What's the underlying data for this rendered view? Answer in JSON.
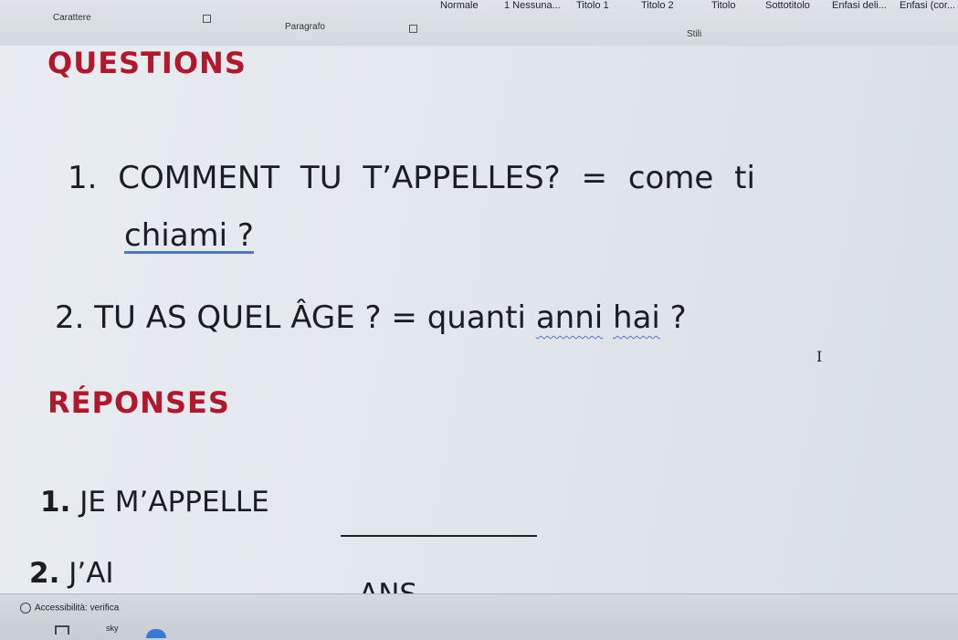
{
  "ribbon": {
    "group_font": "Carattere",
    "group_paragraph": "Paragrafo",
    "group_styles": "Stili",
    "styles": [
      "Normale",
      "1 Nessuna...",
      "Titolo 1",
      "Titolo 2",
      "Titolo",
      "Sottotitolo",
      "Enfasi deli...",
      "Enfasi (cor..."
    ]
  },
  "document": {
    "questions_heading": "QUESTIONS",
    "q1": {
      "num": "1.",
      "text": "COMMENT TU T’APPELLES? = come ti",
      "text_cont": "chiami ?"
    },
    "q2": {
      "num": "2.",
      "text_a": "TU AS QUEL ÂGE ? = quanti ",
      "word1": "anni",
      "space": " ",
      "word2": "hai",
      "text_end": " ?"
    },
    "answers_heading": "RÉPONSES",
    "a1": {
      "num": "1.",
      "text": "JE M’APPELLE"
    },
    "a2": {
      "num": "2.",
      "text": "J’AI",
      "suffix": "ANS"
    }
  },
  "statusbar": {
    "accessibility": "Accessibilità: verifica",
    "taskbar_label": "sky"
  },
  "colors": {
    "heading": "#b2182b",
    "text": "#1c1c22"
  }
}
